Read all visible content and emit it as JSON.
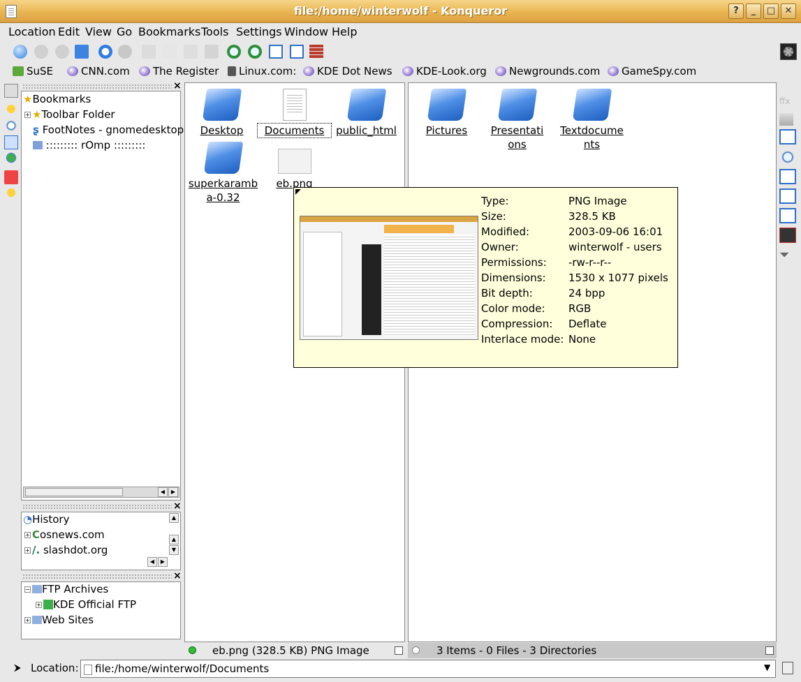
{
  "window": {
    "title": "file:/home/winterwolf - Konqueror",
    "buttons": [
      "?",
      "_",
      "□",
      "✕"
    ]
  },
  "menu": [
    "Location",
    "Edit",
    "View",
    "Go",
    "Bookmarks",
    "Tools",
    "Settings",
    "Window",
    "Help"
  ],
  "bookmark_toolbar": [
    "SuSE",
    "CNN.com",
    "The Register",
    "Linux.com:",
    "KDE Dot News",
    "KDE-Look.org",
    "Newgrounds.com",
    "GameSpy.com"
  ],
  "sidebar": {
    "bookmarks": {
      "root": "Bookmarks",
      "items": [
        "Toolbar Folder",
        "FootNotes - gnomedesktop",
        ":::::::::   rOmp   :::::::::"
      ]
    },
    "history": {
      "root": "History",
      "items": [
        "osnews.com",
        "slashdot.org"
      ]
    },
    "network": {
      "root": "FTP Archives",
      "items": [
        "KDE Official FTP",
        "Web Sites"
      ]
    }
  },
  "left_view": {
    "files": [
      "Desktop",
      "Documents",
      "public_html",
      "superkaramba-0.32",
      "eb.png"
    ],
    "status": "eb.png (328.5 KB)  PNG Image"
  },
  "right_view": {
    "files": [
      "Pictures",
      "Presentations",
      "Textdocuments"
    ],
    "status": "3 Items - 0 Files - 3 Directories"
  },
  "tooltip": {
    "rows": [
      {
        "k": "Type:",
        "v": "PNG Image"
      },
      {
        "k": "Size:",
        "v": "328.5 KB"
      },
      {
        "k": "Modified:",
        "v": "2003-09-06 16:01"
      },
      {
        "k": "Owner:",
        "v": "winterwolf - users"
      },
      {
        "k": "Permissions:",
        "v": "-rw-r--r--"
      },
      {
        "k": "Dimensions:",
        "v": "1530 x 1077 pixels"
      },
      {
        "k": "Bit depth:",
        "v": "24 bpp"
      },
      {
        "k": "Color mode:",
        "v": "RGB"
      },
      {
        "k": "Compression:",
        "v": "Deflate"
      },
      {
        "k": "Interlace mode:",
        "v": "None"
      }
    ]
  },
  "location": {
    "label": "Location:",
    "value": "file:/home/winterwolf/Documents"
  }
}
